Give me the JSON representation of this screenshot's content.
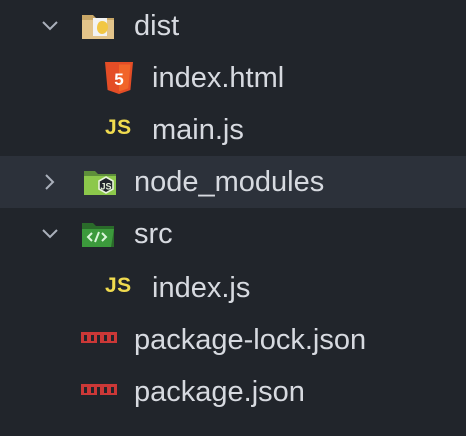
{
  "explorer": {
    "items": [
      {
        "label": "dist",
        "type": "folder",
        "state": "expanded",
        "icon": "dist-folder-icon"
      },
      {
        "label": "index.html",
        "type": "file",
        "icon": "html5-icon"
      },
      {
        "label": "main.js",
        "type": "file",
        "icon": "javascript-icon",
        "icon_text": "JS"
      },
      {
        "label": "node_modules",
        "type": "folder",
        "state": "collapsed",
        "selected": true,
        "icon": "node-folder-icon"
      },
      {
        "label": "src",
        "type": "folder",
        "state": "expanded",
        "icon": "src-folder-icon"
      },
      {
        "label": "index.js",
        "type": "file",
        "icon": "javascript-icon",
        "icon_text": "JS"
      },
      {
        "label": "package-lock.json",
        "type": "file",
        "icon": "npm-icon"
      },
      {
        "label": "package.json",
        "type": "file",
        "icon": "npm-icon"
      }
    ]
  },
  "colors": {
    "background": "#21252b",
    "selected_row": "#2c313a",
    "text": "#d7dae0",
    "chevron": "#aab0bb",
    "html_icon": "#e44d26",
    "js_icon": "#f0db4f",
    "npm_icon": "#cb3837",
    "node_folder": "#8cc84b",
    "src_folder": "#3c9a3c"
  }
}
